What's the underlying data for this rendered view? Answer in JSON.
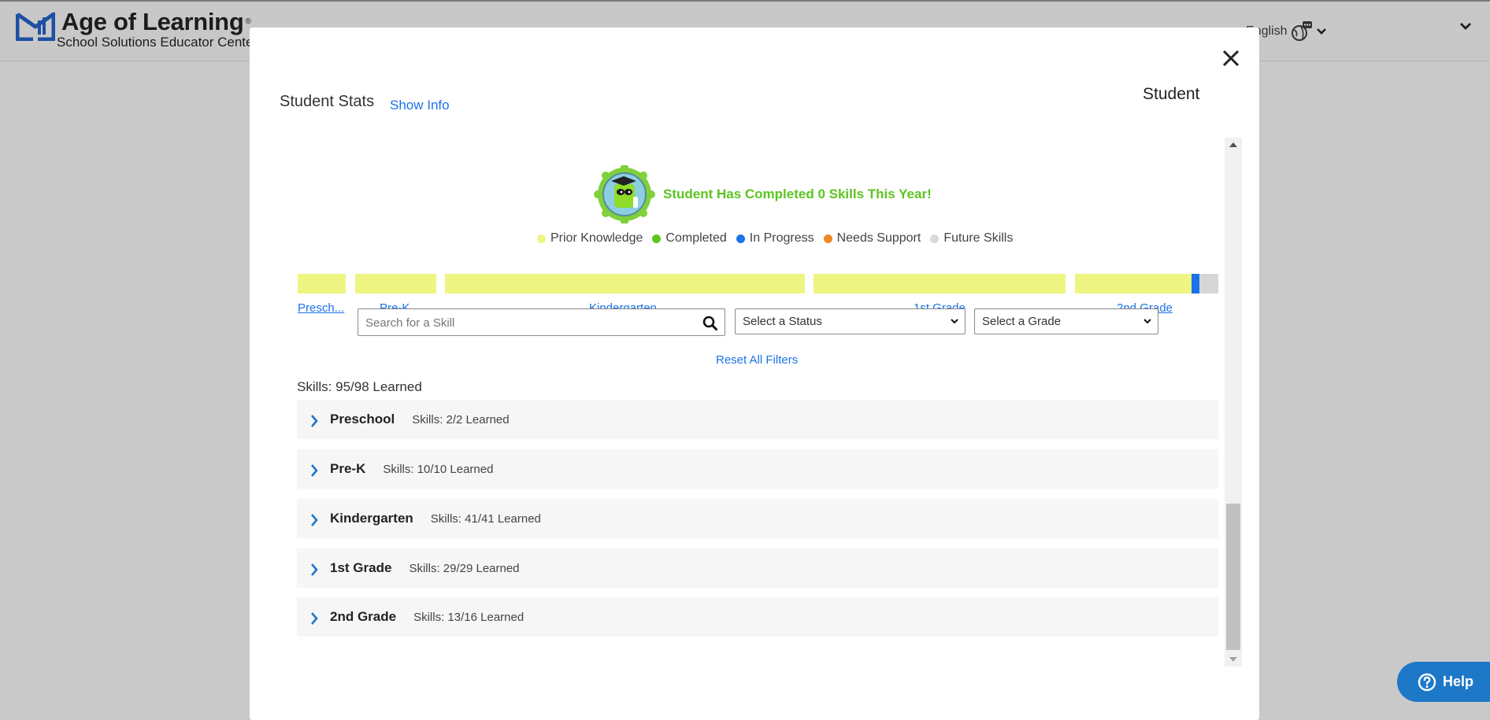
{
  "header": {
    "brand": "Age of Learning",
    "trademark": "®",
    "tagline": "School Solutions Educator Center",
    "language": "English",
    "language_icon": "globe-chat-icon",
    "menu_icon": "chevron-down-icon"
  },
  "modal": {
    "title": "Student Stats",
    "show_info": "Show Info",
    "student_label": "Student",
    "close_icon": "close-icon",
    "banner": "Student Has Completed 0 Skills This Year!",
    "badge_icon": "graduate-mascot-badge-icon",
    "legend": [
      {
        "label": "Prior Knowledge",
        "color": "#eef582"
      },
      {
        "label": "Completed",
        "color": "#5bc51f"
      },
      {
        "label": "In Progress",
        "color": "#1a73e8"
      },
      {
        "label": "Needs Support",
        "color": "#f08a24"
      },
      {
        "label": "Future Skills",
        "color": "#d9d9d9"
      }
    ],
    "grade_labels": [
      "Presch...",
      "Pre-K",
      "Kindergarten",
      "1st Grade",
      "2nd Grade"
    ],
    "filters": {
      "search_placeholder": "Search for a Skill",
      "status": "Select a Status",
      "grade": "Select a Grade",
      "reset": "Reset All Filters"
    },
    "skills_summary": "Skills: 95/98 Learned",
    "grades": [
      {
        "name": "Preschool",
        "count": "Skills: 2/2 Learned"
      },
      {
        "name": "Pre-K",
        "count": "Skills: 10/10 Learned"
      },
      {
        "name": "Kindergarten",
        "count": "Skills: 41/41 Learned"
      },
      {
        "name": "1st Grade",
        "count": "Skills: 29/29 Learned"
      },
      {
        "name": "2nd Grade",
        "count": "Skills: 13/16 Learned"
      }
    ]
  },
  "help": {
    "label": "Help",
    "icon": "question-circle-icon"
  }
}
